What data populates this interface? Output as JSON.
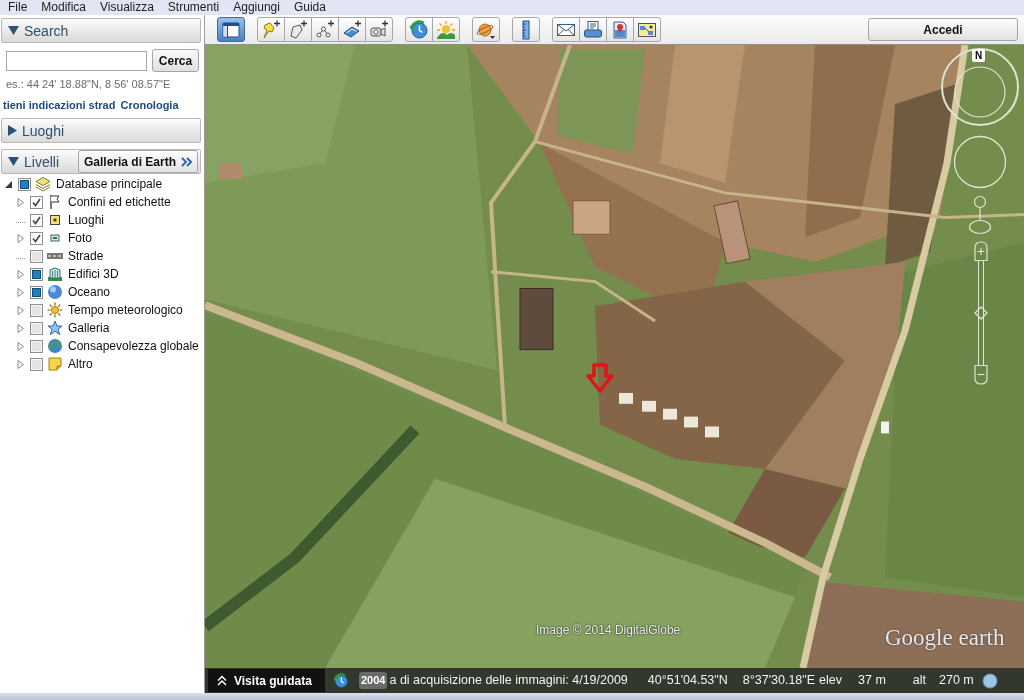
{
  "menu_bar": [
    "File",
    "Modifica",
    "Visualizza",
    "Strumenti",
    "Aggiungi",
    "Guida"
  ],
  "sidebar": {
    "search": {
      "title": "Search",
      "expanded": true,
      "button": "Cerca",
      "hint": "es.: 44 24' 18.88\"N, 8 56' 08.57\"E",
      "links": [
        "tieni indicazioni strad",
        "Cronologia"
      ]
    },
    "places": {
      "title": "Luoghi",
      "expanded": false
    },
    "layers": {
      "title": "Livelli",
      "expanded": true,
      "gallery_button": "Galleria di Earth",
      "tree": [
        {
          "label": "Database principale",
          "kind": "database",
          "checked": false,
          "partial": true,
          "expanded": true,
          "children": [
            {
              "label": "Confini ed etichette",
              "kind": "borders",
              "checked": true,
              "partial": false,
              "expanded": false
            },
            {
              "label": "Luoghi",
              "kind": "places",
              "checked": true,
              "partial": false
            },
            {
              "label": "Foto",
              "kind": "photos",
              "checked": true,
              "partial": false,
              "expanded": false
            },
            {
              "label": "Strade",
              "kind": "roads",
              "checked": false,
              "partial": false
            },
            {
              "label": "Edifici 3D",
              "kind": "buildings",
              "checked": false,
              "partial": true,
              "expanded": false
            },
            {
              "label": "Oceano",
              "kind": "ocean",
              "checked": false,
              "partial": true,
              "expanded": false
            },
            {
              "label": "Tempo meteorologico",
              "kind": "weather",
              "checked": false,
              "partial": false,
              "expanded": false
            },
            {
              "label": "Galleria",
              "kind": "gallery",
              "checked": false,
              "partial": false,
              "expanded": false
            },
            {
              "label": "Consapevolezza globale",
              "kind": "globe",
              "checked": false,
              "partial": false,
              "expanded": false
            },
            {
              "label": "Altro",
              "kind": "note",
              "checked": false,
              "partial": false,
              "expanded": false
            }
          ]
        }
      ]
    }
  },
  "toolbar": {
    "groups": [
      [
        {
          "kind": "sidebar",
          "active": true
        }
      ],
      [
        {
          "kind": "placemark",
          "active": false
        },
        {
          "kind": "polygon",
          "active": false
        },
        {
          "kind": "path",
          "active": false
        },
        {
          "kind": "overlay",
          "active": false
        },
        {
          "kind": "tour",
          "active": false
        }
      ],
      [
        {
          "kind": "history",
          "active": false
        },
        {
          "kind": "sun",
          "active": false
        }
      ],
      [
        {
          "kind": "planet",
          "active": false
        }
      ],
      [
        {
          "kind": "ruler",
          "active": false
        }
      ],
      [
        {
          "kind": "email",
          "active": false
        },
        {
          "kind": "print",
          "active": false
        },
        {
          "kind": "maps",
          "active": false
        },
        {
          "kind": "image",
          "active": false
        }
      ]
    ],
    "sign_in_button": "Accedi"
  },
  "map": {
    "attribution": "Image © 2014 DigitalGlobe",
    "logo": "Google earth",
    "compass_label": "N",
    "zoom_slider": {
      "level": 0.5
    }
  },
  "status_bar": {
    "tour_button": "Visita guidata",
    "imagery_year": "2004",
    "imagery_date": "a di acquisizione delle immagini: 4/19/2009",
    "latitude": "40°51'04.53\"N",
    "longitude": "8°37'30.18\"E",
    "elevation_label": "elev",
    "elevation": "37 m",
    "altitude_label": "alt",
    "altitude": "270 m"
  }
}
